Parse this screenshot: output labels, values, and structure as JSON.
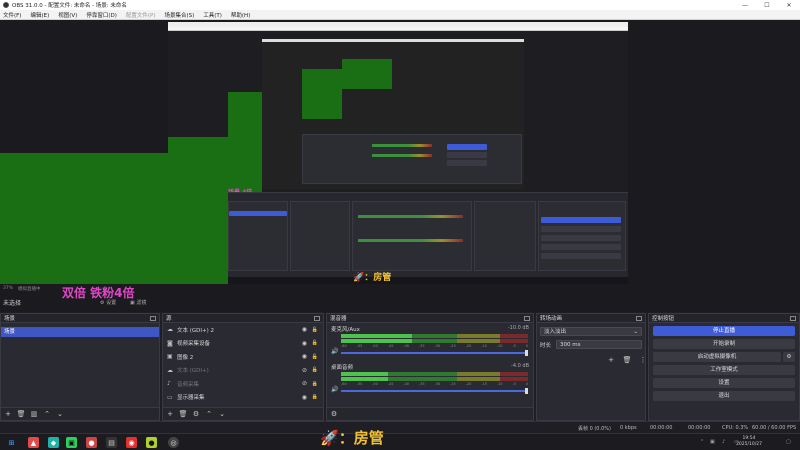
{
  "window": {
    "title": "OBS 31.0.0 - 配置文件: 未命名 - 场景: 未命名",
    "min": "—",
    "max": "☐",
    "close": "✕"
  },
  "menu": [
    {
      "label": "文件(F)",
      "disabled": false
    },
    {
      "label": "编辑(E)",
      "disabled": false
    },
    {
      "label": "视图(V)",
      "disabled": false
    },
    {
      "label": "停靠窗口(D)",
      "disabled": false
    },
    {
      "label": "配置文件(P)",
      "disabled": true
    },
    {
      "label": "场景集合(S)",
      "disabled": false
    },
    {
      "label": "工具(T)",
      "disabled": false
    },
    {
      "label": "帮助(H)",
      "disabled": false
    }
  ],
  "preview": {
    "nested_label": "场景 4倍",
    "fang_guan": "：房管"
  },
  "status_top": {
    "percent": "37%",
    "preview_hint": "模拟直播中",
    "scene_label": "未选择",
    "watermark": "双倍  铁粉4倍",
    "settings": "设置",
    "filter": "滤镜"
  },
  "docks": {
    "scenes": {
      "title": "场景",
      "items": [
        "场景"
      ]
    },
    "sources": {
      "title": "源",
      "items": [
        {
          "icon": "text-icon",
          "glyph": "☁",
          "label": "文本 (GDI+) 2",
          "dim": false
        },
        {
          "icon": "camera-icon",
          "glyph": "📷",
          "label": "视频采集设备",
          "dim": false
        },
        {
          "icon": "image-icon",
          "glyph": "🖼",
          "label": "图像 2",
          "dim": false
        },
        {
          "icon": "text-icon",
          "glyph": "☁",
          "label": "文本 (GDI+)",
          "dim": true
        },
        {
          "icon": "audio-icon",
          "glyph": "🔊",
          "label": "音频采集",
          "dim": true
        },
        {
          "icon": "monitor-icon",
          "glyph": "🖥",
          "label": "显示器采集",
          "dim": false
        }
      ]
    },
    "mixer": {
      "title": "混音器",
      "tracks": [
        {
          "name": "麦克风/Aux",
          "db": "-10.0 dB",
          "level": 0.38
        },
        {
          "name": "桌面音频",
          "db": "-4.0 dB",
          "level": 0.25
        }
      ],
      "scale": [
        "-60",
        "-55",
        "-50",
        "-45",
        "-40",
        "-35",
        "-30",
        "-25",
        "-20",
        "-15",
        "-10",
        "-5",
        "0"
      ]
    },
    "transitions": {
      "title": "转场动画",
      "type": "淡入淡出",
      "duration_label": "时长",
      "duration_value": "300 ms"
    },
    "controls": {
      "title": "控制按钮",
      "buttons": [
        "停止直播",
        "开始录制",
        "启动虚拟摄像机",
        "工作室模式",
        "设置",
        "退出"
      ]
    }
  },
  "statusbar": {
    "frames": "丢帧 0 (0.0%)",
    "bitrate": "0 kbps",
    "rec_time": "00:00:00",
    "stream_time": "00:00:00",
    "cpu": "CPU: 0.3%",
    "fps": "60.00 / 60.00 FPS"
  },
  "taskbar": {
    "time": "19:54",
    "date": "2025/10/27",
    "banner": "：房管",
    "colors": {
      "accent": "#3e5cd8",
      "green": "#1a6e14"
    }
  }
}
